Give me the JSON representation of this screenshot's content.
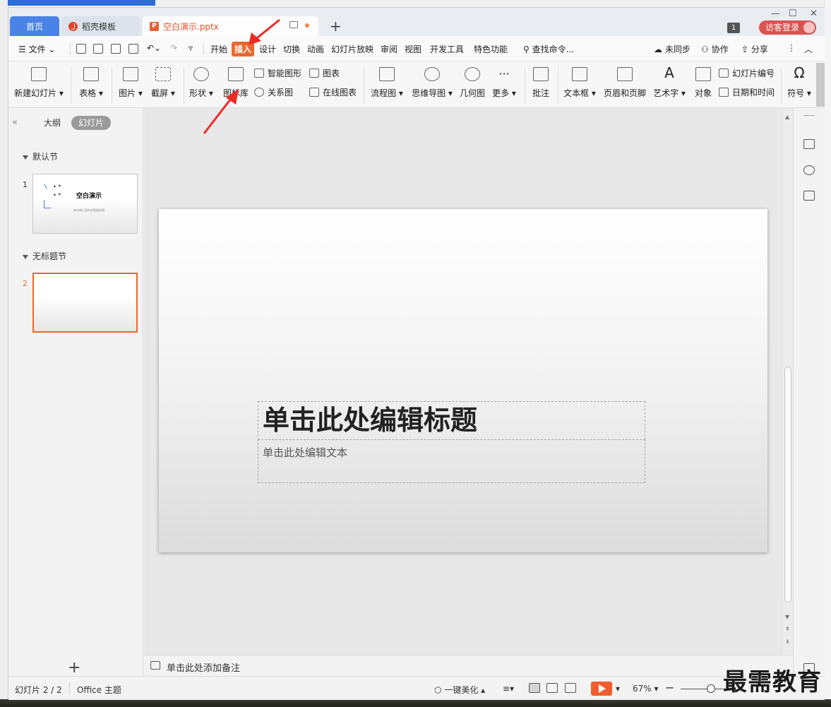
{
  "tabs": {
    "home": "首页",
    "template": "稻壳模板",
    "document": "空白演示.pptx",
    "count_badge": "1",
    "login": "访客登录"
  },
  "menu": {
    "file": "文件",
    "items": [
      "开始",
      "插入",
      "设计",
      "切换",
      "动画",
      "幻灯片放映",
      "审阅",
      "视图",
      "开发工具",
      "特色功能"
    ],
    "active": "插入",
    "search": "查找命令...",
    "sync": "未同步",
    "collab": "协作",
    "share": "分享"
  },
  "ribbon": {
    "new_slide": "新建幻灯片",
    "table": "表格",
    "picture": "图片",
    "screenshot": "截屏",
    "shape": "形状",
    "icon_lib": "图标库",
    "smart_art": "智能图形",
    "relation": "关系图",
    "chart": "图表",
    "online_chart": "在线图表",
    "flowchart": "流程图",
    "mindmap": "思维导图",
    "geometry": "几何图",
    "more": "更多",
    "comment": "批注",
    "textbox": "文本框",
    "header_footer": "页眉和页脚",
    "wordart": "艺术字",
    "object": "对象",
    "slide_number": "幻灯片编号",
    "datetime": "日期和时间",
    "symbol": "符号"
  },
  "left_panel": {
    "outline": "大纲",
    "slides": "幻灯片",
    "section1": "默认节",
    "section2": "无标题节",
    "thumb1_num": "1",
    "thumb1_title": "空白演示",
    "thumb1_sub": "单击输入您的封面副标题",
    "thumb2_num": "2"
  },
  "slide": {
    "title_placeholder": "单击此处编辑标题",
    "subtitle_placeholder": "单击此处编辑文本"
  },
  "notes": {
    "placeholder": "单击此处添加备注"
  },
  "status": {
    "slide_count": "幻灯片 2 / 2",
    "theme": "Office 主题",
    "beautify": "一键美化",
    "zoom": "67%"
  },
  "watermark": "最需教育",
  "colors": {
    "accent": "#e8692e",
    "home_tab": "#4a83e6",
    "login": "#d9534f",
    "arrow": "#ee2a24"
  }
}
